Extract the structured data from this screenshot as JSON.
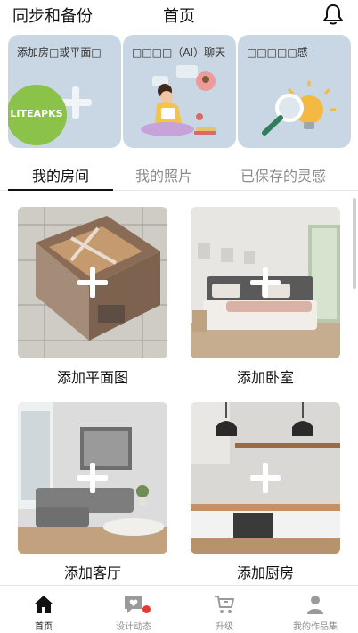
{
  "header": {
    "sync_backup": "同步和备份",
    "title": "首页",
    "bell_icon": "bell-icon"
  },
  "feature_cards": [
    {
      "label": "添加房□或平面□",
      "icon": "plus-icon"
    },
    {
      "label": "□□□□（AI）聊天",
      "icon": "ai-chat-illustration"
    },
    {
      "label": "□□□□□感",
      "icon": "magnifier-bulb-illustration"
    }
  ],
  "badge": {
    "text": "LITEAPKS",
    "color": "#8bc34a"
  },
  "tabs": [
    {
      "label": "我的房间",
      "active": true
    },
    {
      "label": "我的照片",
      "active": false
    },
    {
      "label": "已保存的灵感",
      "active": false
    }
  ],
  "rooms": [
    {
      "label": "添加平面图",
      "icon": "plus-icon"
    },
    {
      "label": "添加卧室",
      "icon": "plus-icon"
    },
    {
      "label": "添加客厅",
      "icon": "plus-icon"
    },
    {
      "label": "添加厨房",
      "icon": "plus-icon"
    }
  ],
  "bottom_nav": [
    {
      "label": "首页",
      "icon": "home-icon",
      "active": true
    },
    {
      "label": "设计动态",
      "icon": "feed-icon",
      "active": false,
      "has_dot": true
    },
    {
      "label": "升级",
      "icon": "cart-icon",
      "active": false
    },
    {
      "label": "我的作品集",
      "icon": "person-icon",
      "active": false
    }
  ],
  "colors": {
    "card_bg": "#c9d6e3",
    "accent_red": "#e53935",
    "text_primary": "#111111",
    "text_secondary": "#8c8c8c"
  }
}
